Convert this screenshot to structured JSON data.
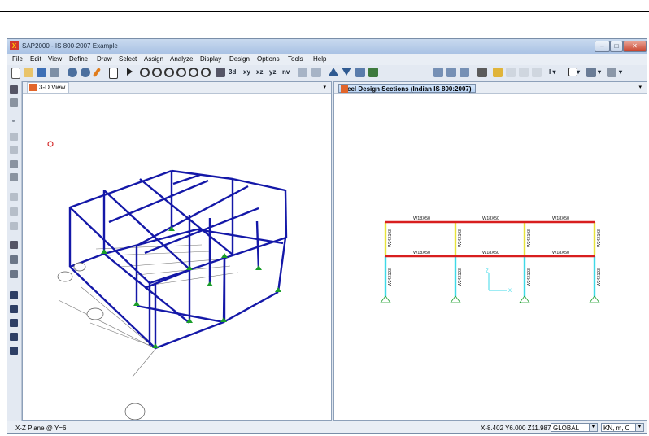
{
  "app": {
    "title": "SAP2000 - IS 800-2007 Example"
  },
  "window_controls": {
    "minimize": "–",
    "maximize": "□",
    "close": "✕"
  },
  "menu": [
    "File",
    "Edit",
    "View",
    "Define",
    "Draw",
    "Select",
    "Assign",
    "Analyze",
    "Display",
    "Design",
    "Options",
    "Tools",
    "Help"
  ],
  "toolbar": {
    "view_buttons": [
      "xy",
      "xz",
      "yz",
      "nv"
    ],
    "icons": [
      "new-icon",
      "open-icon",
      "save-icon",
      "print-icon",
      "undo-icon",
      "redo-icon",
      "pencil-icon",
      "lock-icon",
      "run-icon",
      "zoom-window-icon",
      "zoom-in-icon",
      "zoom-out-icon",
      "zoom-prev-icon",
      "pan-icon",
      "3d-view-icon"
    ]
  },
  "left_pane": {
    "tab_label": "3-D View",
    "dropdown": "▾"
  },
  "right_pane": {
    "tab_label": "Steel Design Sections  (Indian IS 800:2007)",
    "dropdown": "▾",
    "frame": {
      "beam_labels_top": [
        "W18X50",
        "W18X50",
        "W18X50"
      ],
      "beam_labels_bottom": [
        "W18X50",
        "W18X50",
        "W18X50"
      ],
      "column_labels_upper": [
        "W24X103",
        "W24X103",
        "W24X103",
        "W24X103"
      ],
      "column_labels_lower": [
        "W24X103",
        "W24X103",
        "W24X103",
        "W24X103"
      ],
      "axis_z": "Z",
      "axis_x": "X"
    }
  },
  "colors": {
    "frame_3d": "#1418a8",
    "beam_fail": "#d81e1e",
    "column_ok": "#e8e23a",
    "column_low": "#3ed9e8",
    "support": "#1a9e2a"
  },
  "status": {
    "plane": "X-Z Plane @ Y=6",
    "coords": "X-8.402  Y6.000  Z11.987",
    "coord_system": "GLOBAL",
    "units": "KN, m, C"
  }
}
